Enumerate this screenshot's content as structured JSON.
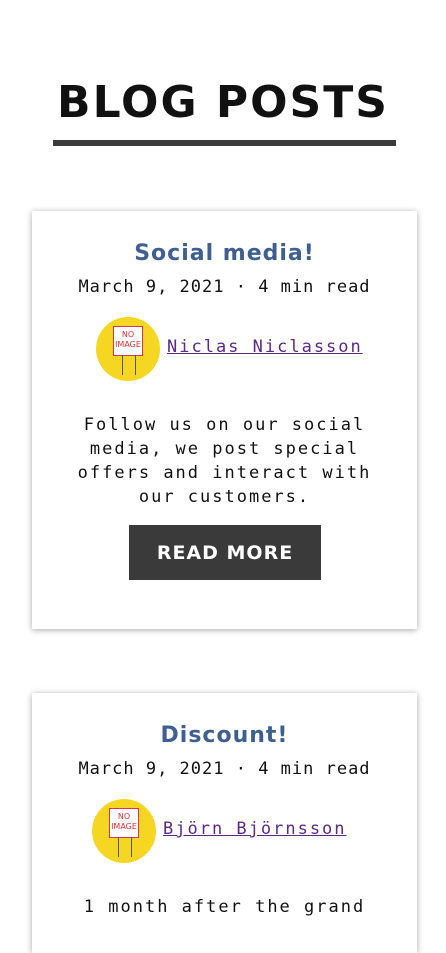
{
  "page": {
    "title": "BLOG POSTS"
  },
  "posts": [
    {
      "title": "Social media!",
      "meta": "March 9, 2021 · 4 min read",
      "author": "Niclas Niclasson",
      "avatar_text": "NO IMAGE",
      "excerpt": "Follow us on our social media, we post special offers and interact with our customers.",
      "button": "READ MORE"
    },
    {
      "title": "Discount!",
      "meta": "March 9, 2021 · 4 min read",
      "author": "Björn Björnsson",
      "avatar_text": "NO IMAGE",
      "excerpt": "1 month after the grand"
    }
  ],
  "colors": {
    "title": "#3e5f8f",
    "link": "#5b2a86",
    "button_bg": "#3a3a3a",
    "avatar_bg": "#f5d623"
  }
}
